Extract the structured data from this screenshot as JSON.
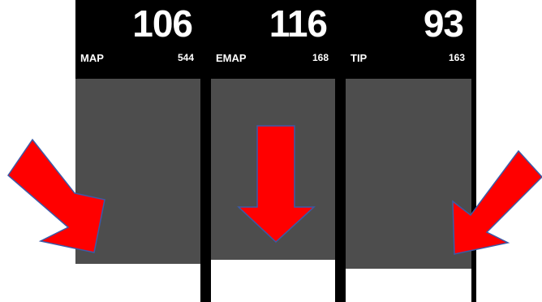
{
  "panels": [
    {
      "label": "MAP",
      "value": "106",
      "sub_value": "544"
    },
    {
      "label": "EMAP",
      "value": "116",
      "sub_value": "168"
    },
    {
      "label": "TIP",
      "value": "93",
      "sub_value": "163"
    }
  ],
  "colors": {
    "background": "#000000",
    "column_fill": "#4d4d4d",
    "level_fill": "#ffffff",
    "arrow": "#ff0000",
    "arrow_outline": "#3b5aa8"
  },
  "icons": {
    "left_arrow": "arrow-down-right-icon",
    "center_arrow": "arrow-down-icon",
    "right_arrow": "arrow-down-left-icon"
  }
}
